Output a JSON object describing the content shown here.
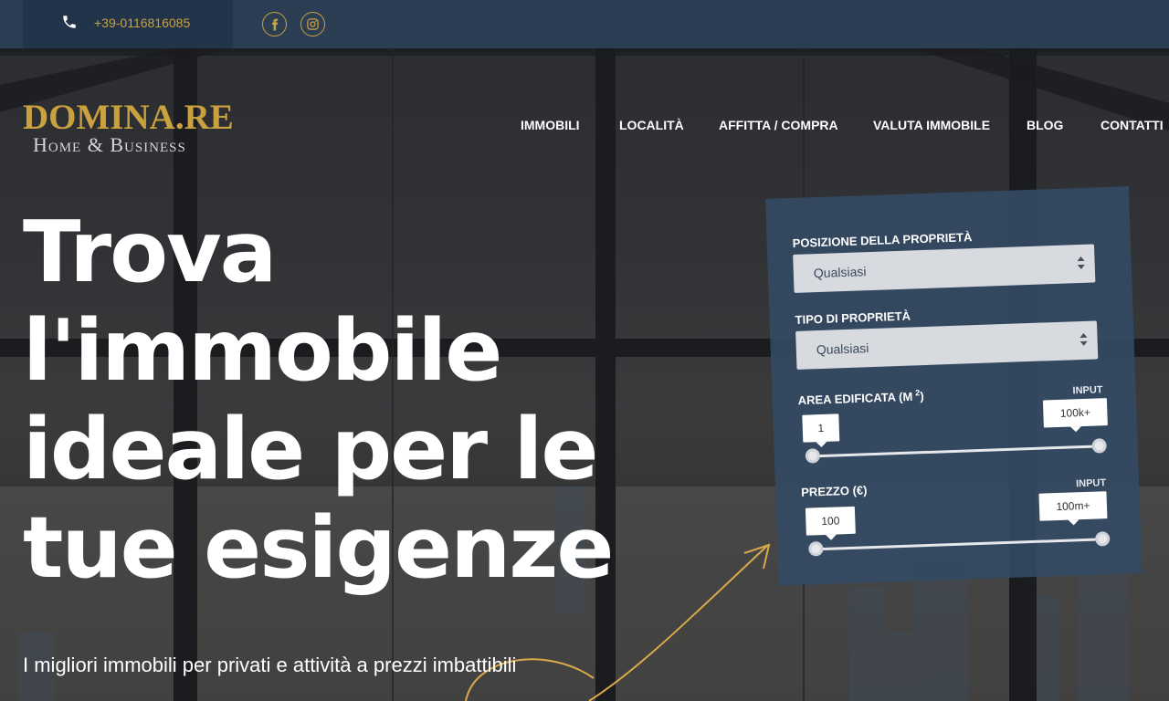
{
  "topbar": {
    "phone_icon": "phone-icon",
    "phone": "+39-0116816085",
    "social": [
      {
        "name": "facebook-icon"
      },
      {
        "name": "instagram-icon"
      }
    ]
  },
  "logo": {
    "main": "DOMINA.RE",
    "sub": "Home & Business"
  },
  "nav": {
    "items": [
      "IMMOBILI",
      "LOCALITÀ",
      "AFFITTA / COMPRA",
      "VALUTA IMMOBILE",
      "BLOG",
      "CONTATTI"
    ]
  },
  "hero": {
    "headline_lines": [
      "Trova",
      "l'immobile",
      "ideale per le",
      "tue esigenze"
    ],
    "subline": "I migliori immobili per privati e attività a prezzi imbattibili"
  },
  "search": {
    "position_label": "POSIZIONE DELLA PROPRIETÀ",
    "position_value": "Qualsiasi",
    "type_label": "TIPO DI PROPRIETÀ",
    "type_value": "Qualsiasi",
    "area_label": "AREA EDIFICATA (M",
    "area_sup": "2",
    "area_label_end": ")",
    "area_input_label": "INPUT",
    "area_min": "1",
    "area_max": "100k+",
    "price_label": "PREZZO (€)",
    "price_input_label": "INPUT",
    "price_min": "100",
    "price_max": "100m+"
  },
  "colors": {
    "accent": "#c9a13f",
    "topbar": "#2c3e53",
    "panel": "#344962"
  }
}
